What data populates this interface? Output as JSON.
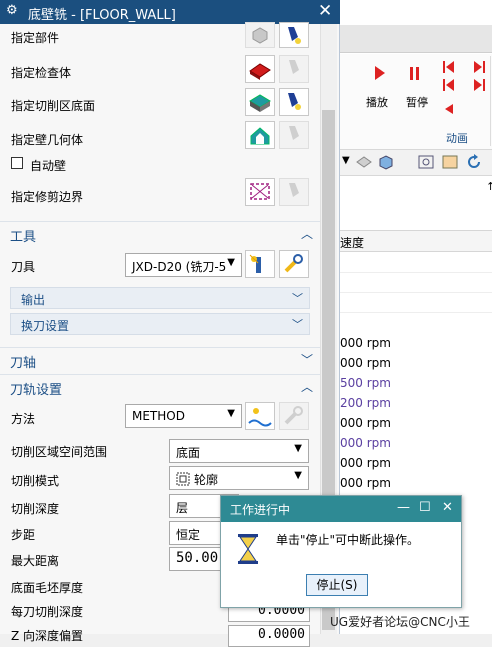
{
  "dialog": {
    "title": "底壁铣 - [FLOOR_WALL]",
    "rows": {
      "part": "指定部件",
      "check": "指定检查体",
      "cut_floor": "指定切削区底面",
      "wall_geom": "指定壁几何体",
      "auto_wall": "自动壁",
      "trim": "指定修剪边界"
    },
    "tool_section": {
      "title": "工具",
      "tool_label": "刀具",
      "tool_value": "JXD-D20 (铣刀-5",
      "output": "输出",
      "tool_change": "换刀设置"
    },
    "axis_section": {
      "title": "刀轴"
    },
    "path_section": {
      "title": "刀轨设置",
      "method_label": "方法",
      "method_value": "METHOD",
      "cut_region_label": "切削区域空间范围",
      "cut_region_value": "底面",
      "cut_mode_label": "切削模式",
      "cut_mode_value": "轮廓",
      "cut_depth_label": "切削深度",
      "cut_depth_value": "层",
      "stepover_label": "步距",
      "stepover_value": "恒定",
      "max_dist_label": "最大距离",
      "max_dist_value": "50.00",
      "floor_stock_label": "底面毛坯厚度",
      "per_cut_depth_label": "每刀切削深度",
      "per_cut_depth_value": "0.0000",
      "z_offset_label": "Z 向深度偏置",
      "z_offset_value": "0.0000"
    }
  },
  "ribbon": {
    "play": "播放",
    "pause": "暂停",
    "group": "动画"
  },
  "table": {
    "header": "速度",
    "speeds": [
      "000 rpm",
      "000 rpm",
      "500 rpm",
      "200 rpm",
      "000 rpm",
      "000 rpm",
      "000 rpm",
      "000 rpm"
    ]
  },
  "progress": {
    "title": "工作进行中",
    "message": "单击\"停止\"可中断此操作。",
    "stop_button": "停止(S)"
  },
  "watermark": "UG爱好者论坛@CNC小王",
  "colors": {
    "titlebar": "#1b4f7f",
    "section": "#1c4f86",
    "popup_title": "#2e8a94",
    "speed_purple": "#5a3fa0"
  }
}
